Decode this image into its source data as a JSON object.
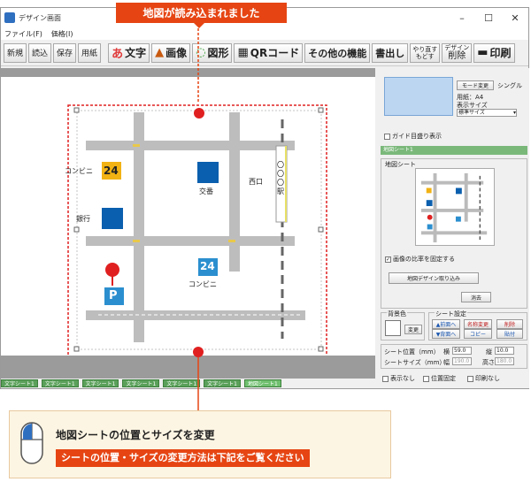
{
  "window": {
    "title": "デザイン画面"
  },
  "window_controls": [
    "–",
    "☐",
    "✕"
  ],
  "menu": [
    "ファイル(F)",
    "価格(I)"
  ],
  "toolbar": {
    "new": "新規",
    "open": "読込",
    "save": "保存",
    "paper": "用紙",
    "text_icon": "あ",
    "text": "文字",
    "image": "画像",
    "shape": "図形",
    "qr": "QRコード",
    "other": "その他の機能",
    "write": "書出し",
    "redo_top": "やり直す",
    "redo_bottom": "もどす",
    "delete_top": "デザイン",
    "delete_bottom": "削除",
    "print": "印刷"
  },
  "map": {
    "convenience_1": "コンビニ",
    "convenience_1_num": "24",
    "convenience_2": "コンビニ",
    "convenience_2_num": "24",
    "bank": "銀行",
    "koban": "交番",
    "west_exit": "西口",
    "station": "〇〇〇駅",
    "parking": "P"
  },
  "sheet_tabs": [
    "文字シート1",
    "文字シート1",
    "文字シート1",
    "文字シート1",
    "文字シート1",
    "文字シート1",
    "地図シート1"
  ],
  "side": {
    "mode_button": "モード変更",
    "mode_value": "シングル",
    "paper_label": "用紙：A4",
    "display_size_label": "表示サイズ",
    "display_size_value": "標準サイズ",
    "guide_label": "ガイド目盛り表示",
    "map_sheet_header": "地図シート1",
    "map_sheet_group": "地図シート",
    "keep_ratio_label": "画像の比率を固定する",
    "import_button": "地図デザイン取り込み",
    "erase_button": "消去",
    "bg_color_label": "背景色",
    "change_button": "変更",
    "sheet_setting_label": "シート設定",
    "front_button": "▲前面へ",
    "back_button": "▼背面へ",
    "rename_button": "名称変更",
    "copy_button": "コピー",
    "delete_button": "削除",
    "paste_button": "貼付",
    "position_label": "シート位置（mm）",
    "size_label": "シートサイズ（mm）",
    "x_label": "横",
    "x_value": "59.0",
    "y_label": "縦",
    "y_value": "10.0",
    "w_label": "幅",
    "w_value": "190.0",
    "h_label": "高さ",
    "h_value": "180.0",
    "hide_label": "表示なし",
    "lock_label": "位置固定",
    "noprint_label": "印刷なし"
  },
  "callouts": {
    "top": "地図が読み込まれました",
    "bottom_title": "地図シートの位置とサイズを変更",
    "bottom_sub": "シートの位置・サイズの変更方法は下記をご覧ください"
  },
  "colors": {
    "accent": "#e64513",
    "road": "#bdbdbd",
    "blue": "#0a5fae",
    "tab_green": "#5aa05a"
  }
}
